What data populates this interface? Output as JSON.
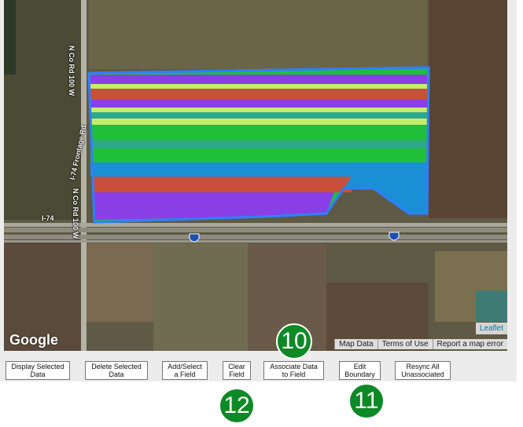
{
  "map": {
    "roads": {
      "vertical_top": "N Co Rd 100 W",
      "vertical_bottom": "N Co Rd 100 W",
      "frontage": "I-74 Frontage Rd",
      "interstate": "I-74",
      "shield_number": "74"
    },
    "google_logo": "Google",
    "leaflet_link": "Leaflet",
    "attribution": {
      "map_data": "Map Data",
      "terms": "Terms of Use",
      "report": "Report a map error"
    },
    "colors": {
      "boundary": "#2f7fff",
      "purple": "#8a3fe6",
      "red": "#c8503a",
      "green": "#1fbf3a",
      "lime": "#c4ee6a",
      "blue": "#1a8fd6",
      "teal": "#2ea88a"
    }
  },
  "buttons": {
    "display": "Display Selected Data",
    "delete": "Delete Selected Data",
    "add_select": "Add/Select a Field",
    "clear": "Clear Field",
    "associate": "Associate Data to Field",
    "edit": "Edit Boundary",
    "resync": "Resync All Unassociated"
  },
  "markers": {
    "m10": "10",
    "m11": "11",
    "m12": "12"
  }
}
